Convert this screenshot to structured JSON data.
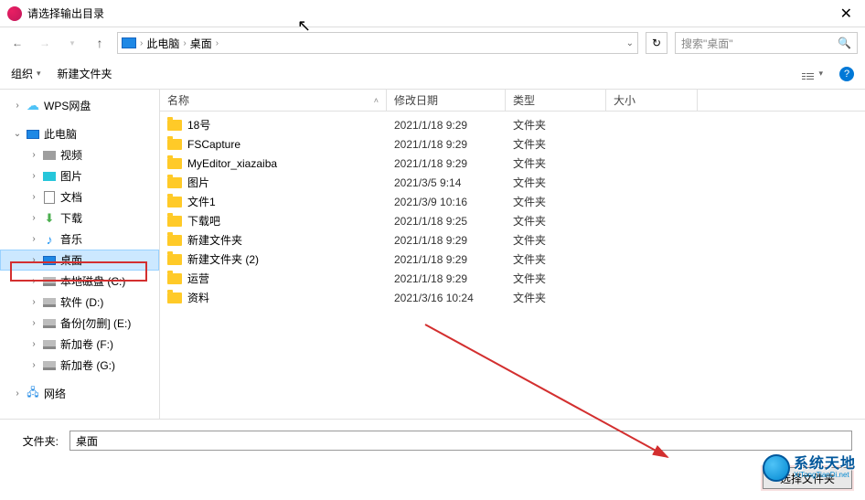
{
  "title": "请选择输出目录",
  "breadcrumb": {
    "part1": "此电脑",
    "part2": "桌面"
  },
  "search_placeholder": "搜索\"桌面\"",
  "toolbar": {
    "organize": "组织",
    "newfolder": "新建文件夹"
  },
  "columns": {
    "name": "名称",
    "date": "修改日期",
    "type": "类型",
    "size": "大小"
  },
  "tree": {
    "wps": "WPS网盘",
    "thispc": "此电脑",
    "video": "视频",
    "pictures": "图片",
    "documents": "文档",
    "downloads": "下载",
    "music": "音乐",
    "desktop": "桌面",
    "diskC": "本地磁盘 (C:)",
    "diskD": "软件 (D:)",
    "diskE": "备份[勿删] (E:)",
    "diskF": "新加卷 (F:)",
    "diskG": "新加卷 (G:)",
    "network": "网络"
  },
  "files": [
    {
      "name": "18号",
      "date": "2021/1/18 9:29",
      "type": "文件夹"
    },
    {
      "name": "FSCapture",
      "date": "2021/1/18 9:29",
      "type": "文件夹"
    },
    {
      "name": "MyEditor_xiazaiba",
      "date": "2021/1/18 9:29",
      "type": "文件夹"
    },
    {
      "name": "图片",
      "date": "2021/3/5 9:14",
      "type": "文件夹"
    },
    {
      "name": "文件1",
      "date": "2021/3/9 10:16",
      "type": "文件夹"
    },
    {
      "name": "下载吧",
      "date": "2021/1/18 9:25",
      "type": "文件夹"
    },
    {
      "name": "新建文件夹",
      "date": "2021/1/18 9:29",
      "type": "文件夹"
    },
    {
      "name": "新建文件夹 (2)",
      "date": "2021/1/18 9:29",
      "type": "文件夹"
    },
    {
      "name": "运营",
      "date": "2021/1/18 9:29",
      "type": "文件夹"
    },
    {
      "name": "资料",
      "date": "2021/3/16 10:24",
      "type": "文件夹"
    }
  ],
  "folder_label": "文件夹:",
  "folder_value": "桌面",
  "select_btn": "选择文件夹",
  "watermark": {
    "cn": "系统天地",
    "en": "XiTongTianDi.net"
  }
}
